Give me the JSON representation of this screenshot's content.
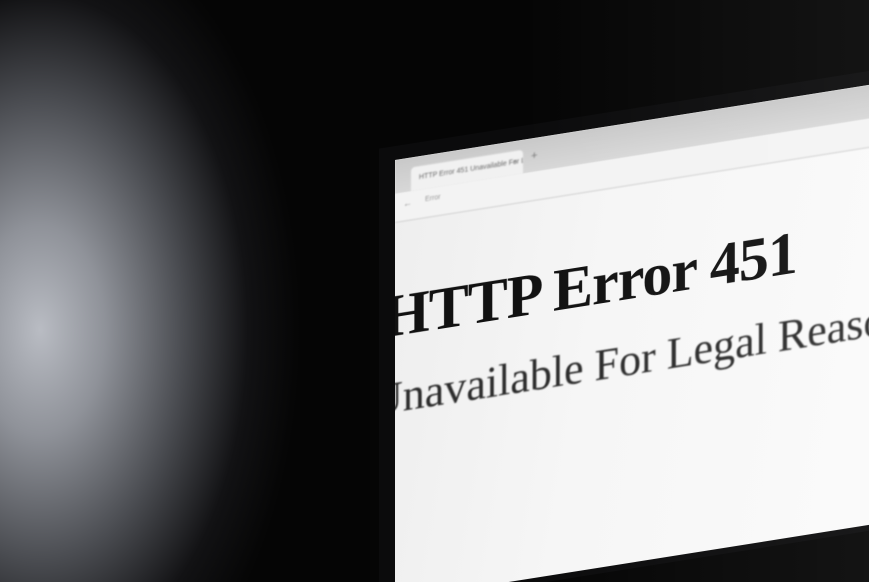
{
  "browser": {
    "tab_title": "HTTP Error 451 Unavailable For L",
    "tab_close": "×",
    "new_tab": "+",
    "nav_arrow": "←",
    "url": "Error"
  },
  "page": {
    "heading": "HTTP Error 451",
    "subheading": "Unavailable For Legal Reasons"
  }
}
